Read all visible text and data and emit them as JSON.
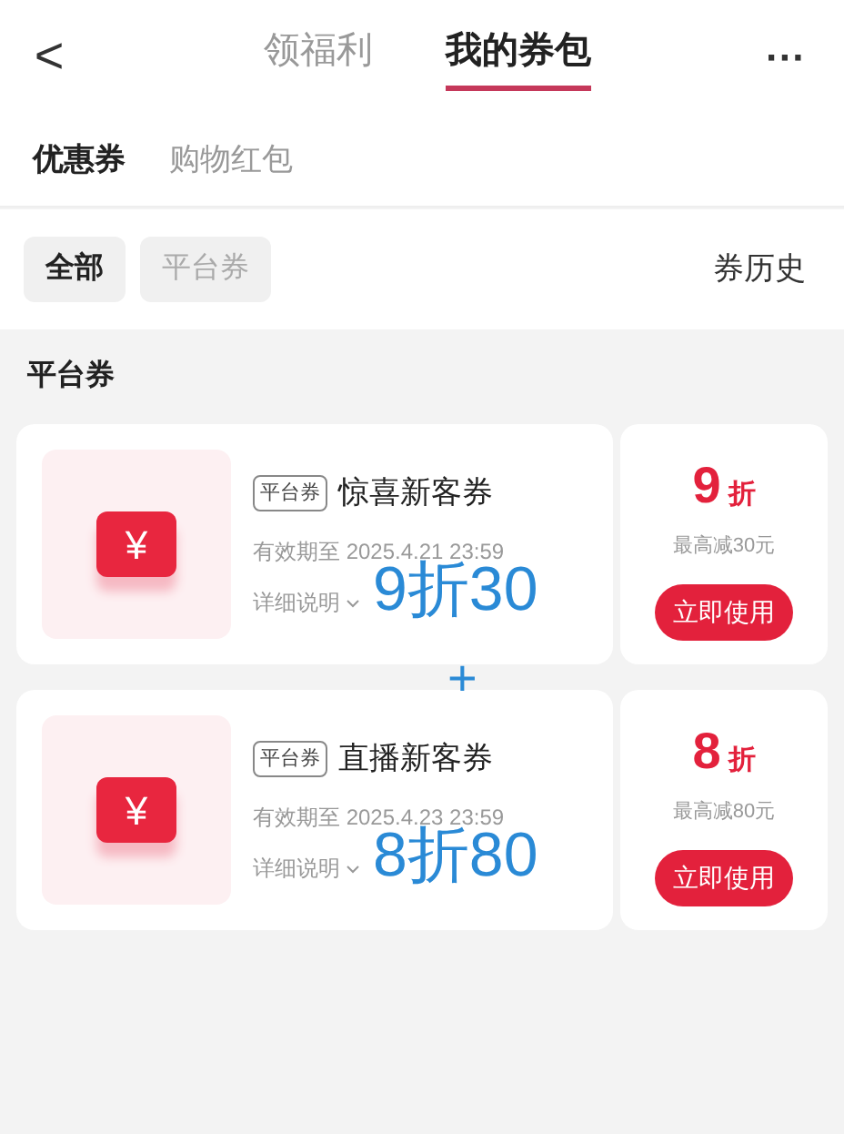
{
  "nav": {
    "back": "<",
    "tabs": [
      {
        "label": "领福利",
        "selected": false
      },
      {
        "label": "我的券包",
        "selected": true
      }
    ],
    "more": "···"
  },
  "subtabs": [
    {
      "label": "优惠券",
      "selected": true
    },
    {
      "label": "购物红包",
      "selected": false
    }
  ],
  "filters": [
    {
      "label": "全部",
      "selected": true
    },
    {
      "label": "平台券",
      "selected": false
    }
  ],
  "history": "券历史",
  "section_title": "平台券",
  "coupons": [
    {
      "glyph": "¥",
      "tag": "平台券",
      "name": "惊喜新客券",
      "expiry": "有效期至 2025.4.21 23:59",
      "details": "详细说明",
      "value": "9",
      "unit": "折",
      "limit": "最高减30元",
      "button": "立即使用",
      "annotation": "9折30"
    },
    {
      "glyph": "¥",
      "tag": "平台券",
      "name": "直播新客券",
      "expiry": "有效期至 2025.4.23 23:59",
      "details": "详细说明",
      "value": "8",
      "unit": "折",
      "limit": "最高减80元",
      "button": "立即使用",
      "annotation": "8折80"
    }
  ],
  "plus": "+"
}
